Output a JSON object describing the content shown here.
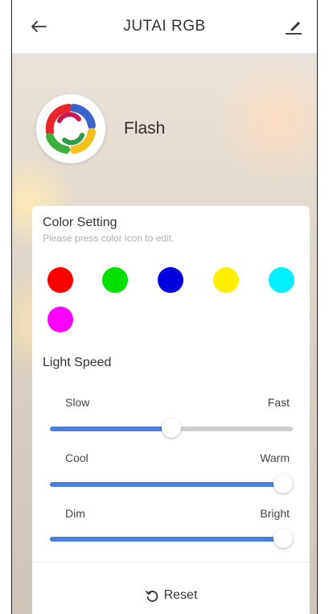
{
  "header": {
    "title": "JUTAI RGB"
  },
  "mode": {
    "name": "Flash"
  },
  "color_setting": {
    "title": "Color Setting",
    "hint": "Please press color icon to edit.",
    "colors": [
      "#ff0000",
      "#00e000",
      "#0000dd",
      "#ffee00",
      "#00f0ff",
      "#ff00ff"
    ]
  },
  "light_speed": {
    "title": "Light Speed",
    "sliders": [
      {
        "min_label": "Slow",
        "max_label": "Fast",
        "value": 0.5
      },
      {
        "min_label": "Cool",
        "max_label": "Warm",
        "value": 0.96
      },
      {
        "min_label": "Dim",
        "max_label": "Bright",
        "value": 0.96
      }
    ],
    "accent_color": "#4a7fde"
  },
  "reset": {
    "label": "Reset"
  }
}
